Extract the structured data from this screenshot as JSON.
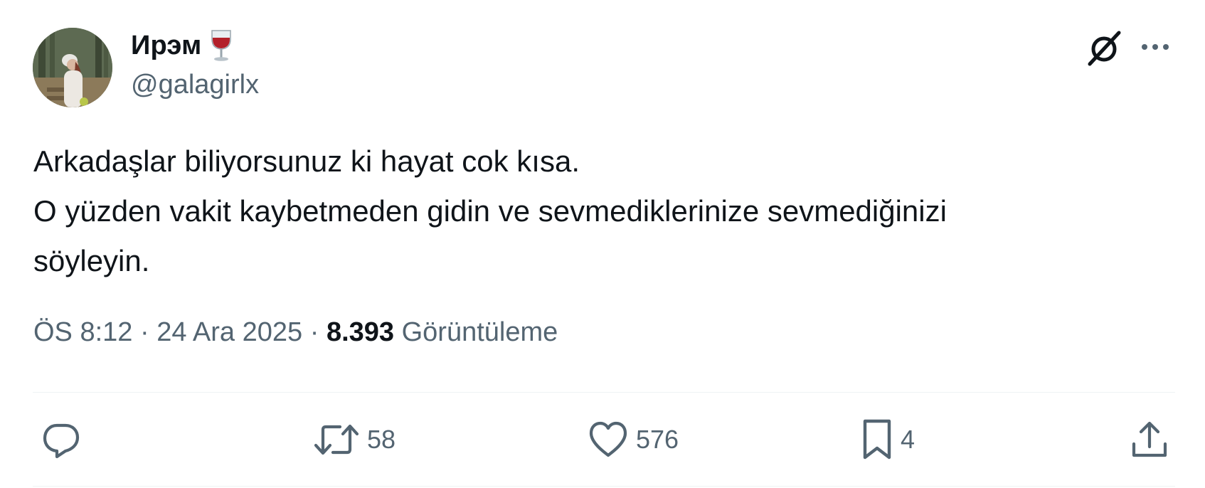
{
  "author": {
    "display_name": "Ирэм",
    "emoji_icon": "wine-glass-icon",
    "handle": "@galagirlx"
  },
  "header_actions": {
    "grok_icon": "grok-icon",
    "more_icon": "more-options-icon"
  },
  "tweet": {
    "lines": [
      "Arkadaşlar biliyorsunuz ki hayat cok kısa.",
      "O yüzden vakit kaybetmeden gidin ve sevmediklerinize sevmediğinizi",
      "söyleyin."
    ]
  },
  "meta": {
    "time": "ÖS 8:12",
    "separator1": "·",
    "date": "24 Ara 2025",
    "separator2": "·",
    "views_count": "8.393",
    "views_label": "Görüntüleme"
  },
  "actions": {
    "reply": {
      "icon": "reply-icon",
      "count": ""
    },
    "retweet": {
      "icon": "retweet-icon",
      "count": "58"
    },
    "like": {
      "icon": "heart-icon",
      "count": "576"
    },
    "bookmark": {
      "icon": "bookmark-icon",
      "count": "4"
    },
    "share": {
      "icon": "share-icon"
    }
  },
  "colors": {
    "text_primary": "#0f1419",
    "text_secondary": "#536471",
    "divider": "#eff3f4",
    "wine": "#b3202a"
  }
}
